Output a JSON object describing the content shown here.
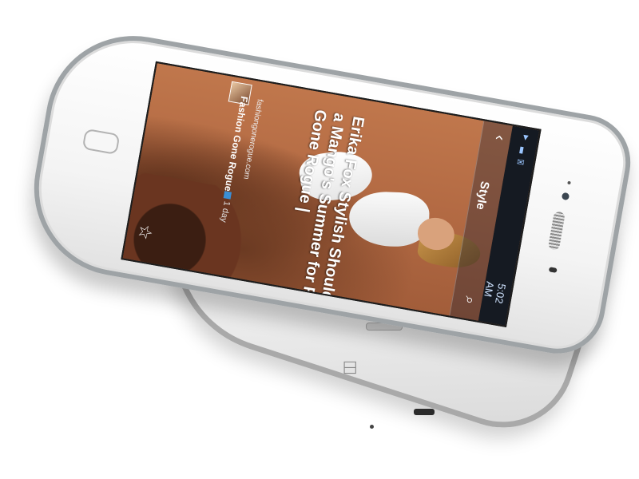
{
  "screen": {
    "article": {
      "headline": "Erika Fox Stylish Shoulder Has a Mango's Summer for Fashion Gone Rogue |",
      "source_url": "fashiongonerogue.com",
      "source_name": "Fashion Gone Rogue",
      "time": "1 day"
    },
    "action_bar": {
      "title": "Style"
    },
    "status_bar": {
      "time": "5:02 AM"
    }
  },
  "icons": [
    "star-icon",
    "search-icon",
    "back-chevron-icon",
    "home-button",
    "twitter-badge-icon"
  ]
}
